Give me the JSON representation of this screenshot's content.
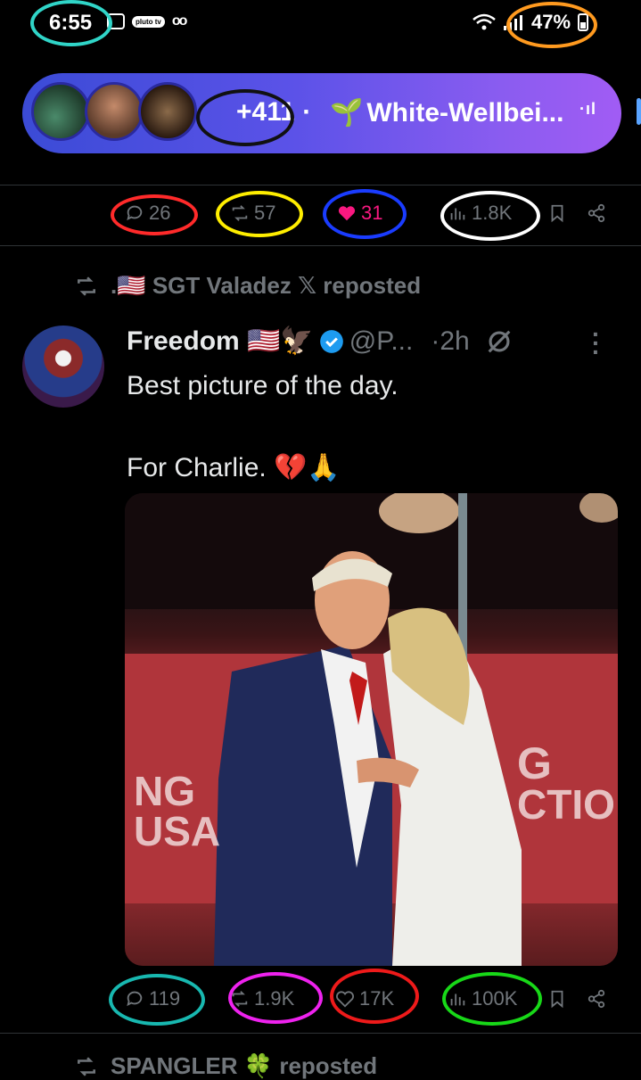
{
  "status_bar": {
    "time": "6:55",
    "app_icons": [
      "gallery-icon",
      "pluto-tv-icon",
      "voicemail-icon"
    ],
    "pluto_label": "pluto tv",
    "voicemail_glyph": "oo",
    "battery": "47%"
  },
  "spaces": {
    "listener_count": "+411",
    "separator": "·",
    "title": "White-Wellbei...",
    "title_emoji": "🌱",
    "audio_glyph": "·ıl",
    "gradient_start": "#3b4bd6",
    "gradient_end": "#a15cf4"
  },
  "prev_tweet_actions": {
    "replies": "26",
    "reposts": "57",
    "likes": "31",
    "views": "1.8K"
  },
  "repost_context": {
    "text": ".🇺🇸 SGT Valadez 𝕏 reposted"
  },
  "tweet": {
    "author_name": "Freedom 🇺🇸🦅",
    "handle": "@P...",
    "time": "·2h",
    "text": "Best picture of the day.\n\nFor Charlie. 💔🙏",
    "image_description": "photo",
    "replies": "119",
    "reposts": "1.9K",
    "likes": "17K",
    "views": "100K"
  },
  "next_repost": {
    "text": "SPANGLER 🍀 reposted"
  },
  "colors": {
    "background": "#000000",
    "muted": "#71767b",
    "like_pink": "#f91880",
    "verified_blue": "#1d9bf0"
  }
}
